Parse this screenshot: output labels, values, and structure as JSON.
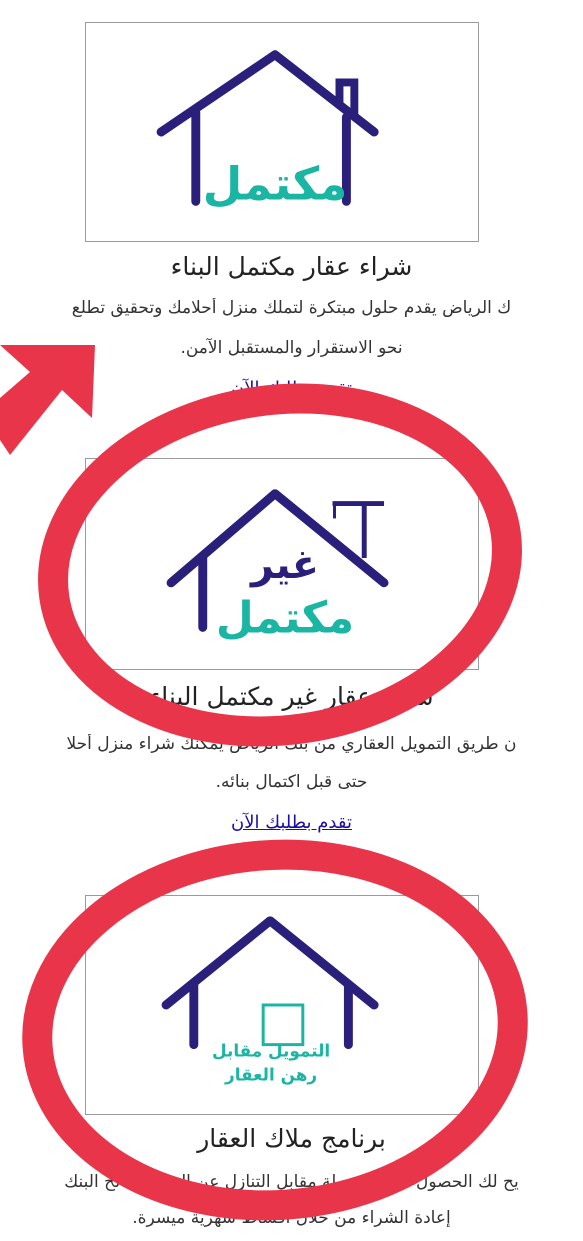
{
  "sections": [
    {
      "logo_text": "مكتمل",
      "title": "شراء عقار مكتمل البناء",
      "desc_line1": "ك الرياض يقدم حلول مبتكرة لتملك منزل أحلامك وتحقيق تطلع",
      "desc_line2": "نحو الاستقرار والمستقبل الآمن.",
      "link": "تقدم بطلبك الآن"
    },
    {
      "logo_text_1": "غير",
      "logo_text_2": "مكتمل",
      "title": "شراء عقار غير مكتمل البناء",
      "desc_line1": "ن طريق التمويل العقاري من بنك الرياض يمكنك شراء منزل أحلا",
      "desc_line2": "حتى قبل اكتمال بنائه.",
      "link": "تقدم بطلبك الآن"
    },
    {
      "logo_text_1": "التمويل مقابل",
      "logo_text_2": "رهن العقار",
      "title": "برنامج ملاك العقار",
      "desc_line1": "يح لك الحصول على السيولة مقابل التنازل عن العقار لصالح البنك",
      "desc_line2": "إعادة الشراء من خلال أقساط شهرية ميسرة."
    }
  ],
  "colors": {
    "navy": "#2a1f7a",
    "teal": "#1ab5a3",
    "annotation_red": "#e8354a"
  }
}
